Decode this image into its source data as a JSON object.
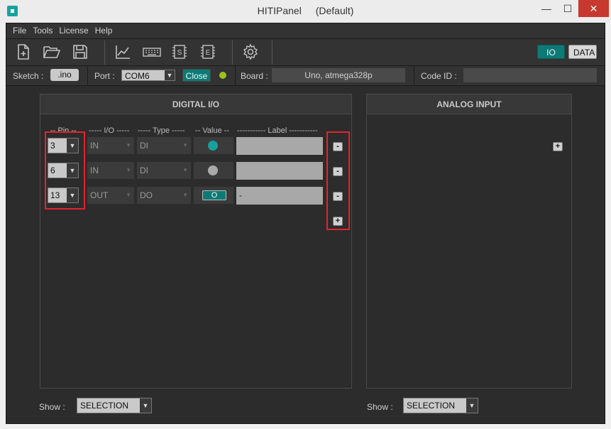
{
  "window": {
    "app_name": "HITIPanel",
    "profile": "(Default)",
    "min_label": "—",
    "max_label": "☐",
    "close_label": "✕"
  },
  "menu": [
    "File",
    "Tools",
    "License",
    "Help"
  ],
  "toolbar": {
    "icons": [
      "new-file-icon",
      "open-folder-icon",
      "save-icon",
      "chart-icon",
      "keyboard-icon",
      "sketch-icon",
      "eeprom-icon",
      "settings-icon"
    ],
    "io_label": "IO",
    "data_label": "DATA"
  },
  "info": {
    "sketch_label": "Sketch :",
    "sketch_value": ".ino",
    "port_label": "Port :",
    "port_value": "COM6",
    "close_button": "Close",
    "board_label": "Board :",
    "board_value": "Uno, atmega328p",
    "code_id_label": "Code ID :",
    "code_id_value": "",
    "status_color": "#9bc41a"
  },
  "digital": {
    "title": "DIGITAL   I/O",
    "headers": {
      "pin": "-- Pin --",
      "io": "----- I/O -----",
      "type": "----- Type -----",
      "value": "-- Value --",
      "label": "----------- Label -----------"
    },
    "rows": [
      {
        "pin": "3",
        "io": "IN",
        "type": "DI",
        "value_kind": "led",
        "value_color": "#17a09c",
        "label": ""
      },
      {
        "pin": "6",
        "io": "IN",
        "type": "DI",
        "value_kind": "led",
        "value_color": "#a9a9a9",
        "label": ""
      },
      {
        "pin": "13",
        "io": "OUT",
        "type": "DO",
        "value_kind": "button",
        "button_label": "O",
        "label": "-"
      }
    ],
    "remove_label": "-",
    "add_label": "+",
    "show_label": "Show :",
    "show_value": "SELECTION"
  },
  "analog": {
    "title": "ANALOG  INPUT",
    "add_label": "+",
    "show_label": "Show :",
    "show_value": "SELECTION"
  },
  "dropdown_arrow": "▼",
  "highlight_color": "#e0242e"
}
